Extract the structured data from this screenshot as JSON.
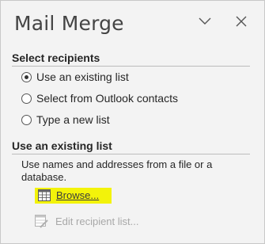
{
  "pane": {
    "title": "Mail Merge",
    "collapse_icon": "chevron-down-icon",
    "close_icon": "close-icon"
  },
  "select_recipients": {
    "heading": "Select recipients",
    "options": [
      {
        "label": "Use an existing list",
        "selected": true
      },
      {
        "label": "Select from Outlook contacts",
        "selected": false
      },
      {
        "label": "Type a new list",
        "selected": false
      }
    ]
  },
  "existing_list": {
    "heading": "Use an existing list",
    "description": "Use names and addresses from a file or a database.",
    "browse_label": "Browse...",
    "browse_icon": "table-grid-icon",
    "browse_highlight": "#f3f30a",
    "edit_label": "Edit recipient list...",
    "edit_icon": "edit-list-icon",
    "edit_enabled": false
  }
}
